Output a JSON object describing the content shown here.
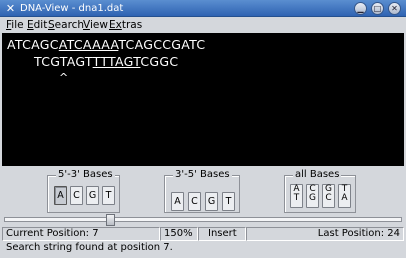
{
  "window": {
    "title": "DNA-View - dna1.dat",
    "app_icon": "x-logo-icon",
    "buttons": [
      "minimize-icon",
      "maximize-icon",
      "close-icon"
    ]
  },
  "menubar": {
    "items": [
      {
        "label_rest": "ile",
        "label_ul": "F"
      },
      {
        "label_rest": "dit",
        "label_ul": "E"
      },
      {
        "label_rest": "earch",
        "label_ul": "S"
      },
      {
        "label_rest": "iew",
        "label_ul": "V"
      },
      {
        "label_rest": "tras",
        "label_ul": "Ex"
      }
    ]
  },
  "sequence": {
    "strand1": {
      "pre": "ATCAGC",
      "match": "ATCAAAA",
      "post": "TCAGCCGATC"
    },
    "strand2": {
      "pre": "TCGTAGT",
      "match": "TTTAGT",
      "post": "CGGC"
    },
    "cursor": "^"
  },
  "groups": [
    {
      "title": "5'-3' Bases",
      "buttons": [
        "A",
        "C",
        "G",
        "T"
      ],
      "pressed": 0
    },
    {
      "title": "3'-5' Bases",
      "buttons": [
        "A",
        "C",
        "G",
        "T"
      ]
    },
    {
      "title": "all Bases",
      "buttons": [
        [
          "A",
          "T"
        ],
        [
          "C",
          "G"
        ],
        [
          "G",
          "C"
        ],
        [
          "T",
          "A"
        ]
      ]
    }
  ],
  "status": {
    "current_position": "Current Position: 7",
    "zoom": "150%",
    "mode": "Insert",
    "last_position": "Last Position: 24",
    "message": "Search string found at position 7."
  }
}
